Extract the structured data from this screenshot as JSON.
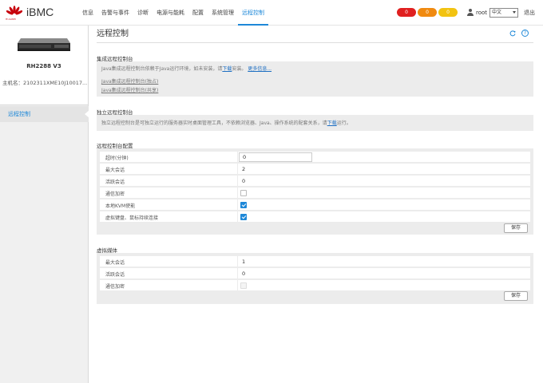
{
  "header": {
    "brand": "iBMC",
    "brand_sub": "HUAWEI",
    "nav": [
      "信息",
      "告警与事件",
      "诊断",
      "电源与能耗",
      "配置",
      "系统管理",
      "远程控制"
    ],
    "active_nav_index": 6,
    "badges": [
      {
        "count": "0",
        "color": "#e02020"
      },
      {
        "count": "0",
        "color": "#f08a10"
      },
      {
        "count": "0",
        "color": "#f2c311"
      }
    ],
    "user": "root",
    "language": "中文",
    "logout": "退出"
  },
  "sidebar": {
    "model": "RH2288 V3",
    "host": "主机名：2102311XME10J10017...",
    "items": [
      {
        "label": "远程控制"
      }
    ]
  },
  "main": {
    "title": "远程控制",
    "integrated": {
      "title": "集成远程控制台",
      "desc_pre": "Java集成远程控制台依赖于Java运行环境，如未安装，请",
      "desc_link": "下载",
      "desc_mid": "安装。",
      "desc_more": "更多信息...",
      "link_exclusive": "Java集成远程控制台(独占)",
      "link_shared": "Java集成远程控制台(共享)"
    },
    "standalone": {
      "title": "独立远程控制台",
      "desc_pre": "独立远程控制台是可独立运行的服务器实时桌面管理工具，不依赖浏览器、Java、操作系统的配套关系，请",
      "desc_link": "下载",
      "desc_post": "运行。"
    },
    "config": {
      "title": "远程控制台配置",
      "rows": [
        {
          "label": "超时(分钟)",
          "value": "0",
          "type": "input"
        },
        {
          "label": "最大会话",
          "value": "2",
          "type": "text"
        },
        {
          "label": "活跃会话",
          "value": "0",
          "type": "text"
        },
        {
          "label": "通信加密",
          "checked": false,
          "type": "checkbox"
        },
        {
          "label": "本地KVM使能",
          "checked": true,
          "type": "checkbox"
        },
        {
          "label": "虚拟键盘、鼠标持续连接",
          "checked": true,
          "type": "checkbox"
        }
      ],
      "save_label": "保存"
    },
    "vmedia": {
      "title": "虚拟媒体",
      "rows": [
        {
          "label": "最大会话",
          "value": "1",
          "type": "text"
        },
        {
          "label": "活跃会话",
          "value": "0",
          "type": "text"
        },
        {
          "label": "通信加密",
          "checked": false,
          "type": "checkbox"
        }
      ],
      "save_label": "保存"
    }
  }
}
